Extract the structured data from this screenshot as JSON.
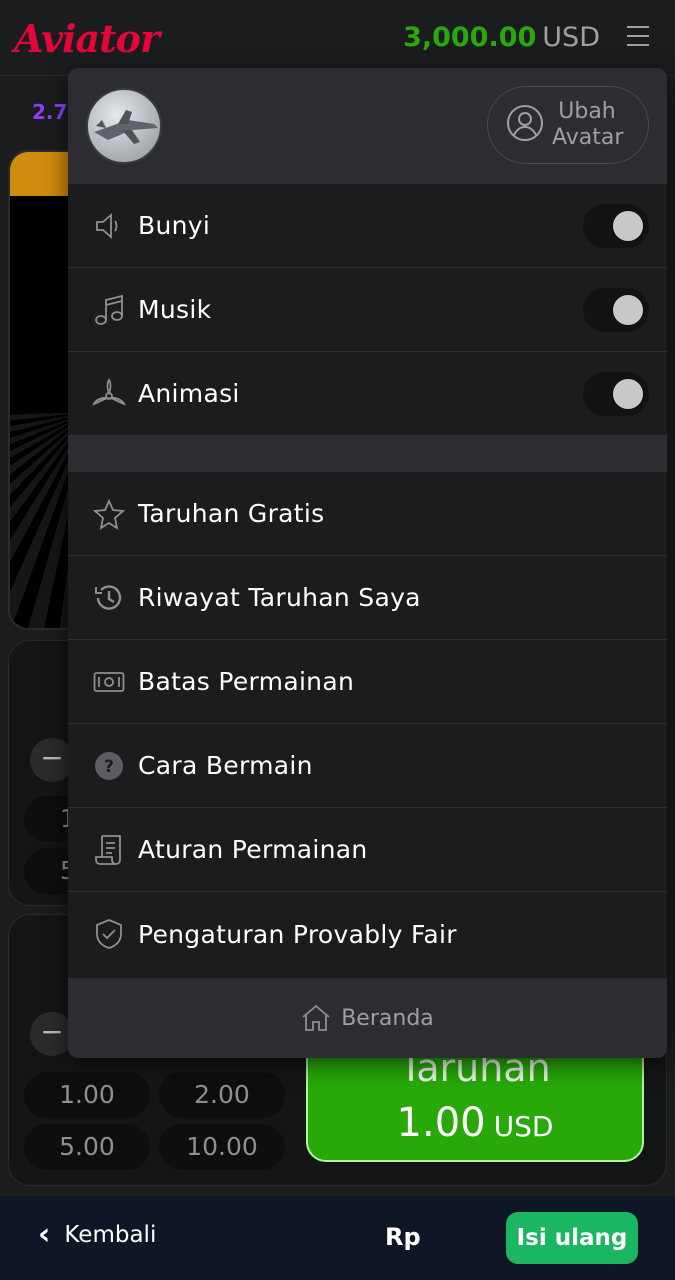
{
  "header": {
    "logo": "Aviator",
    "balance_amount": "3,000.00",
    "balance_currency": "USD",
    "accent_logo": "#e50539",
    "accent_balance": "#28a909"
  },
  "background": {
    "multiplier_partial": "2.7",
    "chips_top": [
      "1",
      "5"
    ],
    "chips": [
      "1.00",
      "2.00",
      "5.00",
      "10.00"
    ],
    "bet_button": {
      "label": "Taruhan",
      "amount": "1.00",
      "currency": "USD",
      "color": "#28a909"
    }
  },
  "menu": {
    "change_avatar_label": "Ubah Avatar",
    "settings": [
      {
        "label": "Bunyi",
        "icon": "speaker-icon",
        "enabled": false
      },
      {
        "label": "Musik",
        "icon": "music-note-icon",
        "enabled": false
      },
      {
        "label": "Animasi",
        "icon": "propeller-icon",
        "enabled": false
      }
    ],
    "items": [
      {
        "label": "Taruhan Gratis",
        "icon": "star-icon"
      },
      {
        "label": "Riwayat Taruhan Saya",
        "icon": "history-icon"
      },
      {
        "label": "Batas Permainan",
        "icon": "banknote-icon"
      },
      {
        "label": "Cara Bermain",
        "icon": "question-circle-icon"
      },
      {
        "label": "Aturan Permainan",
        "icon": "document-scroll-icon"
      },
      {
        "label": "Pengaturan Provably Fair",
        "icon": "shield-check-icon"
      }
    ],
    "footer_label": "Beranda"
  },
  "bottom_bar": {
    "back_label": "Kembali",
    "currency_label": "Rp",
    "refill_label": "Isi ulang",
    "refill_color": "#1bb662"
  }
}
